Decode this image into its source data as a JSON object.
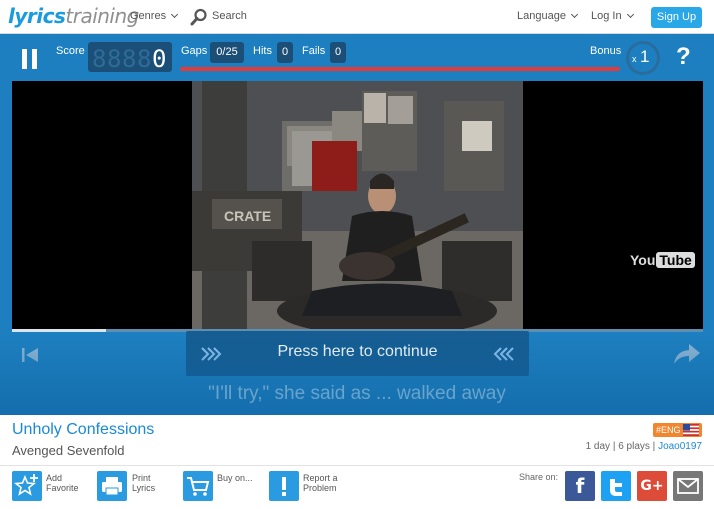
{
  "nav": {
    "logo_a": "lyrics",
    "logo_b": "training",
    "genres": "Genres",
    "search": "Search",
    "language": "Language",
    "login": "Log In",
    "signup": "Sign Up"
  },
  "player": {
    "score_label": "Score",
    "score_digits": [
      "8",
      "8",
      "8",
      "8",
      "0"
    ],
    "gaps_label": "Gaps",
    "gaps_value": "0/25",
    "hits_label": "Hits",
    "hits_value": "0",
    "fails_label": "Fails",
    "fails_value": "0",
    "bonus_label": "Bonus",
    "bonus_x": "x",
    "bonus_value": "1",
    "help": "?",
    "continue_label": "Press here to continue",
    "lyric_line": "\"I'll try,\" she said as ... walked away",
    "video_progress": 0.136,
    "youtube_a": "You",
    "youtube_b": "Tube"
  },
  "song": {
    "title": "Unholy Confessions",
    "artist": "Avenged Sevenfold",
    "lang_badge": "#ENG",
    "meta_prefix": "1 day | 6 plays | ",
    "meta_user": "Joao0197"
  },
  "actions": {
    "add": [
      "Add",
      "Favorite"
    ],
    "print": [
      "Print",
      "Lyrics"
    ],
    "buy": [
      "Buy on...",
      ""
    ],
    "report": [
      "Report a",
      "Problem"
    ],
    "share_label": "Share on:"
  },
  "colors": {
    "accent": "#2a9be0",
    "player_bg": "#1d7fbf",
    "facebook": "#3b5998",
    "twitter": "#1da1f2",
    "gplus": "#dd4b39",
    "mail": "#777777",
    "badge": "#f1862e"
  }
}
